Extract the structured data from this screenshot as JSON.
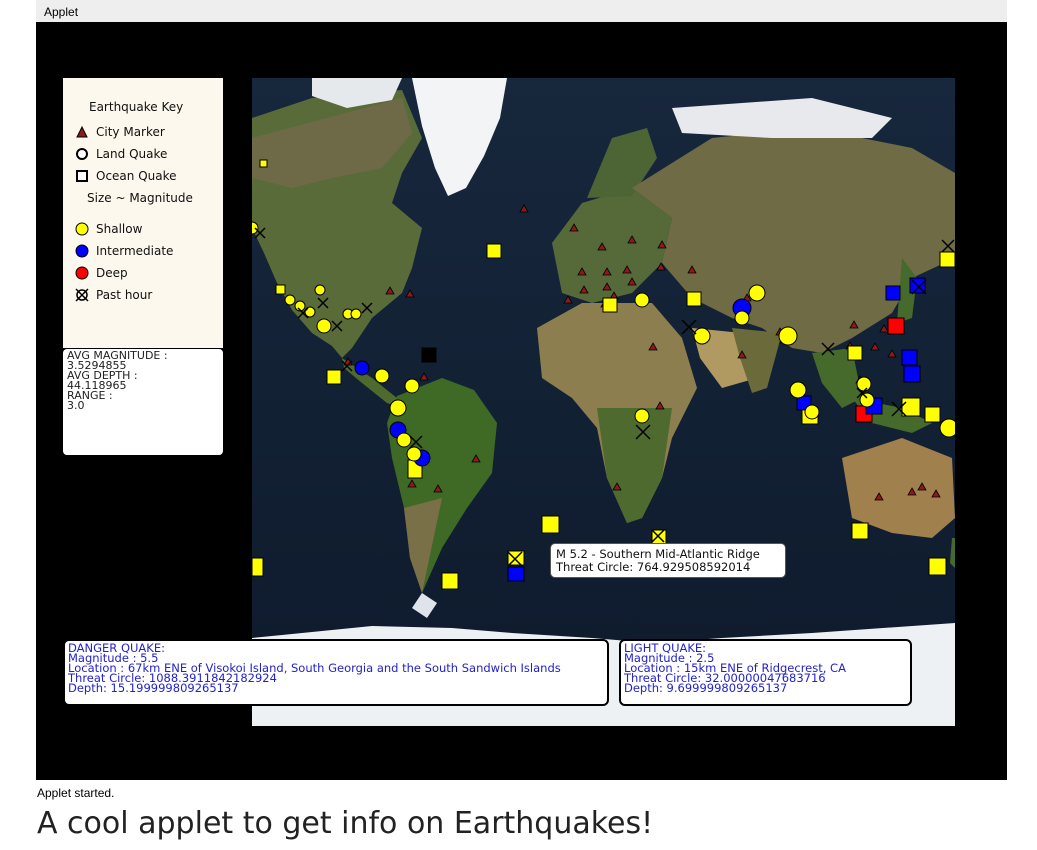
{
  "window": {
    "title": "Applet"
  },
  "key": {
    "title": "Earthquake Key",
    "items": [
      {
        "label": "City Marker",
        "icon": "triangle-icon",
        "color": "#8b1a1a"
      },
      {
        "label": "Land Quake",
        "icon": "circle-outline-icon"
      },
      {
        "label": "Ocean Quake",
        "icon": "square-outline-icon"
      },
      {
        "label": "Size ~ Magnitude",
        "icon": ""
      },
      {
        "label": "Shallow",
        "icon": "circle-icon",
        "color": "#ffff00"
      },
      {
        "label": "Intermediate",
        "icon": "circle-icon",
        "color": "#0000ff"
      },
      {
        "label": "Deep",
        "icon": "circle-icon",
        "color": "#ff0000"
      },
      {
        "label": "Past hour",
        "icon": "crossed-circle-icon"
      }
    ]
  },
  "stats": {
    "avg_magnitude_label": "AVG MAGNITUDE :",
    "avg_magnitude": "3.5294855",
    "avg_depth_label": "AVG DEPTH :",
    "avg_depth": "44.118965",
    "range_label": "RANGE :",
    "range": "3.0"
  },
  "danger_quake": {
    "title": "DANGER QUAKE:",
    "magnitude": " Magnitude : 5.5",
    "location": " Location :  67km ENE of Visokoi Island, South Georgia and the South Sandwich Islands",
    "threat": " Threat Circle: 1088.3911842182924",
    "depth": " Depth: 15.199999809265137"
  },
  "light_quake": {
    "title": "LIGHT QUAKE:",
    "magnitude": " Magnitude : 2.5",
    "location": " Location :  15km ENE of Ridgecrest, CA",
    "threat": " Threat Circle: 32.00000047683716",
    "depth": " Depth: 9.699999809265137"
  },
  "tooltip": {
    "line1": "M 5.2 - Southern Mid-Atlantic Ridge",
    "line2": "Threat Circle: 764.929508592014"
  },
  "colors": {
    "shallow": "#ffff00",
    "intermediate": "#0000ff",
    "deep": "#ff0000",
    "city": "#8b1a1a"
  },
  "status_text": "Applet started.",
  "caption": "A cool applet to get info on Earthquakes!"
}
